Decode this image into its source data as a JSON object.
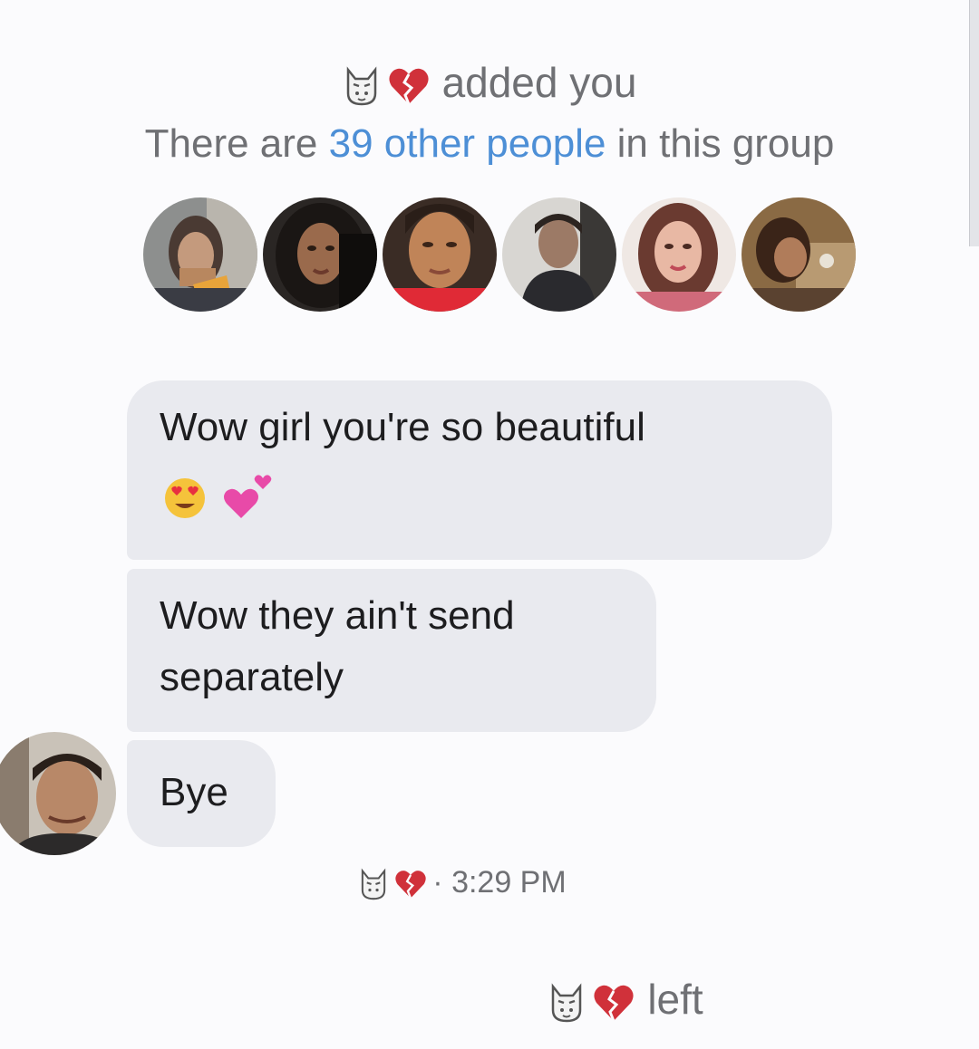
{
  "header": {
    "added_text": "added you",
    "group_prefix": "There are ",
    "group_link": "39 other people",
    "group_suffix": " in this group"
  },
  "group_members": [
    {
      "icon": "member-avatar-photo-1"
    },
    {
      "icon": "member-avatar-photo-2"
    },
    {
      "icon": "member-avatar-photo-3"
    },
    {
      "icon": "member-avatar-photo-4"
    },
    {
      "icon": "member-avatar-photo-5"
    },
    {
      "icon": "member-avatar-photo-6"
    }
  ],
  "messages": [
    {
      "text": "Wow girl you're so beautiful",
      "emojis": [
        "smiling-face-with-heart-eyes",
        "two-hearts"
      ]
    },
    {
      "text": "Wow they ain't send separately"
    },
    {
      "text": "Bye"
    }
  ],
  "read_receipt": {
    "time": "· 3:29 PM"
  },
  "footer": {
    "left_text": "left"
  },
  "sender_name_emojis": [
    "cat-mask-icon",
    "broken-heart-icon"
  ],
  "colors": {
    "link": "#4d8fd6",
    "bubble": "#e9eaef",
    "system_text": "#6f7074",
    "heart": "#d0313a"
  }
}
